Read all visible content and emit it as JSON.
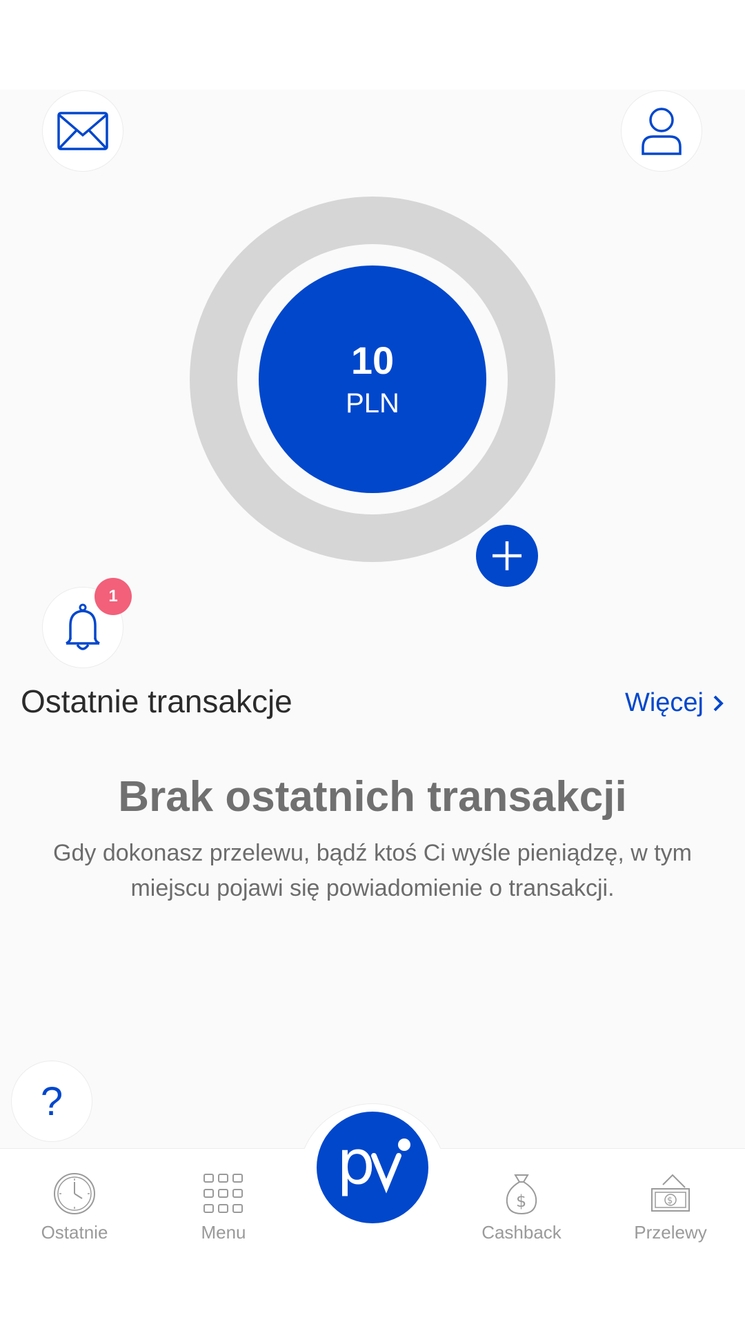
{
  "balance": {
    "amount": "10",
    "currency": "PLN"
  },
  "notifications": {
    "badge_count": "1"
  },
  "transactions": {
    "title": "Ostatnie transakcje",
    "more_label": "Więcej",
    "empty_title": "Brak ostatnich transakcji",
    "empty_description": "Gdy dokonasz przelewu, bądź ktoś Ci wyśle pieniądzę, w tym miejscu pojawi się powiadomienie o transakcji."
  },
  "help": {
    "label": "?"
  },
  "nav": {
    "items": [
      {
        "label": "Ostatnie",
        "icon": "clock-icon"
      },
      {
        "label": "Menu",
        "icon": "grid-icon"
      },
      {
        "label": "Cashback",
        "icon": "money-bag-icon"
      },
      {
        "label": "Przelewy",
        "icon": "banknotes-icon"
      }
    ],
    "center_logo": "pv"
  },
  "colors": {
    "accent": "#0047cc",
    "badge": "#f2607a",
    "ring": "#d6d6d6",
    "muted": "#9a9a9a"
  }
}
